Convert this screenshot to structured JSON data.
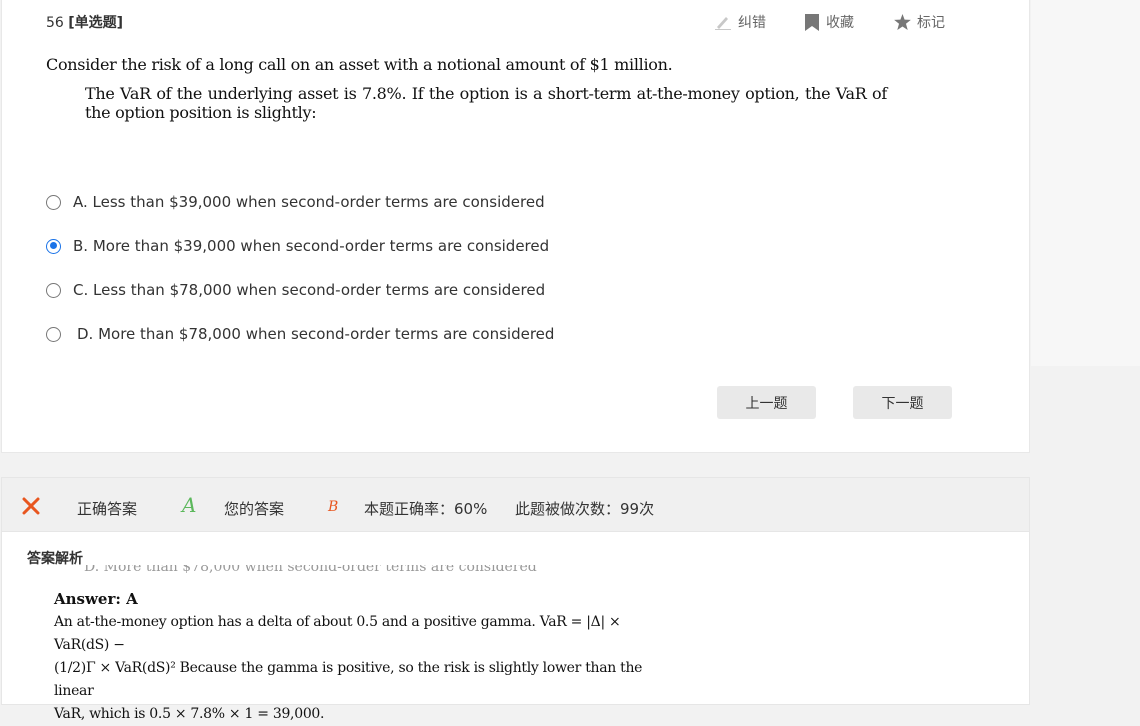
{
  "question": {
    "number": "56",
    "type": "[单选题]",
    "stem": "Consider the risk of a long call on an asset with a notional amount of $1 million.",
    "detail": "The VaR of the underlying asset is 7.8%. If the option is a short-term at-the-money option, the VaR of the option position is slightly:"
  },
  "toolbar": {
    "correct_error": "纠错",
    "favorite": "收藏",
    "mark": "标记"
  },
  "options": [
    {
      "text": "A. Less than $39,000 when second-order terms are considered",
      "selected": false
    },
    {
      "text": "B. More than $39,000 when second-order terms are considered",
      "selected": true
    },
    {
      "text": "C. Less than $78,000 when second-order terms are considered",
      "selected": false
    },
    {
      "text": "D. More than $78,000 when second-order terms are considered",
      "selected": false
    }
  ],
  "nav": {
    "prev": "上一题",
    "next": "下一题"
  },
  "result": {
    "correct_label": "正确答案",
    "correct_answer": "A",
    "your_label": "您的答案",
    "your_answer": "B",
    "accuracy": "本题正确率：60%",
    "attempts": "此题被做次数：99次",
    "status_color": "#e8561f",
    "correct_color": "#5cb85c"
  },
  "explanation": {
    "title": "答案解析",
    "cut_line": "D. More than $78,000 when second-order terms are considered",
    "answer_head": "Answer: A",
    "line1": "An at-the-money option has a delta of about 0.5 and a positive gamma.  VaR = |Δ| × VaR(dS) −",
    "line2": "(1/2)Γ × VaR(dS)² Because the gamma is positive, so the risk is slightly lower than the linear",
    "line3": "VaR, which is  0.5 × 7.8% × 1 = 39,000."
  }
}
